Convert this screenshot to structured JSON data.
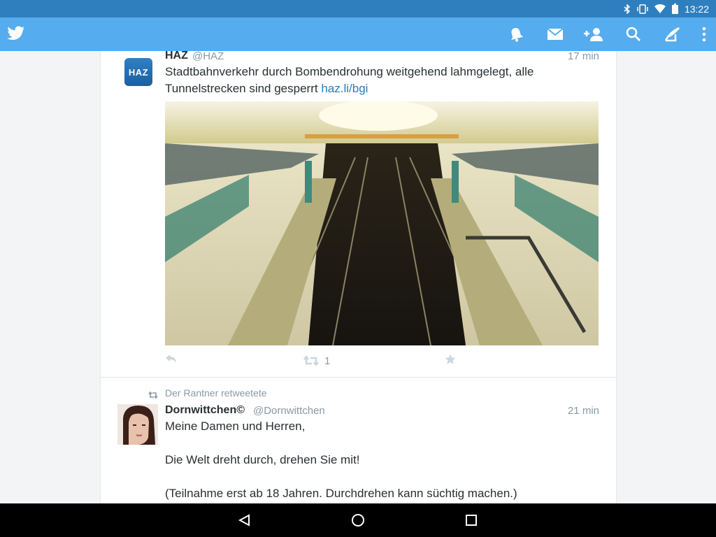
{
  "status_bar": {
    "time": "13:22",
    "icons": [
      "bluetooth-icon",
      "vibrate-icon",
      "wifi-icon",
      "battery-icon"
    ]
  },
  "app_bar": {
    "logo": "twitter-bird-icon",
    "actions": [
      "notifications-icon",
      "messages-icon",
      "add-user-icon",
      "search-icon",
      "compose-icon",
      "overflow-menu-icon"
    ]
  },
  "tweets": [
    {
      "avatar_text": "HAZ",
      "name": "HAZ",
      "handle": "@HAZ",
      "time": "17 min",
      "text_line1": "Stadtbahnverkehr durch Bombendrohung weitgehend lahmgelegt, alle",
      "text_line2_prefix": "Tunnelstrecken sind gesperrt ",
      "link": "haz.li/bgi",
      "retweet_count": "1"
    },
    {
      "retweeted_by": "Der Rantner retweetete",
      "name": "Dornwittchen©",
      "handle": "@Dornwittchen",
      "time": "21 min",
      "line1": "Meine Damen und Herren,",
      "line2": "Die Welt dreht durch, drehen Sie mit!",
      "line3": "(Teilnahme erst ab 18 Jahren. Durchdrehen kann süchtig machen.)"
    }
  ],
  "nav_bar": [
    "back-icon",
    "home-icon",
    "recents-icon"
  ],
  "colors": {
    "status_bar": "#2f7fbf",
    "app_bar": "#55acee",
    "link": "#2b7bb9",
    "meta_text": "#8899a6"
  }
}
